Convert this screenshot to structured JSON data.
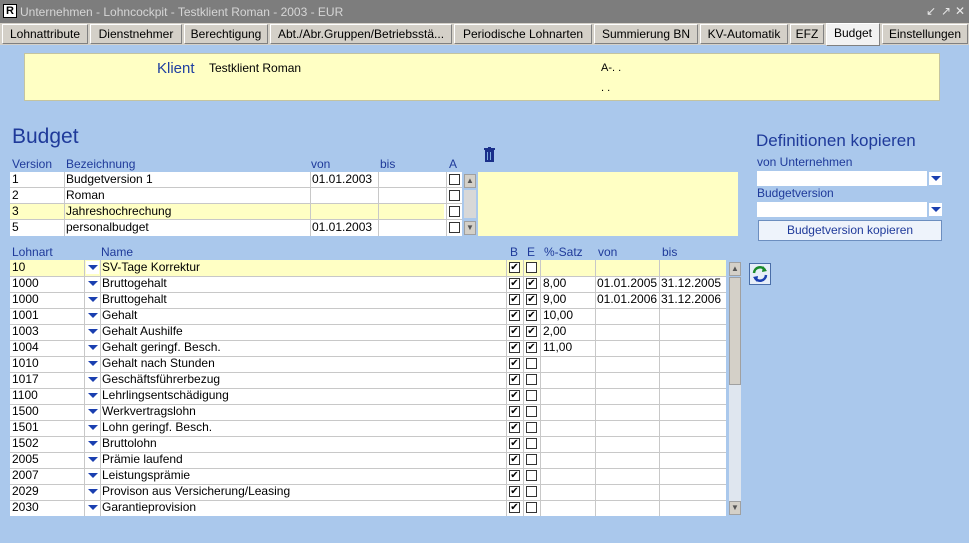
{
  "window": {
    "title": "Unternehmen - Lohncockpit - Testklient Roman - 2003 - EUR",
    "app_icon": "R",
    "controls": [
      "↙",
      "↗",
      "✕"
    ]
  },
  "tabs": [
    {
      "label": "Lohnattribute",
      "active": false
    },
    {
      "label": "Dienstnehmer",
      "active": false
    },
    {
      "label": "Berechtigung",
      "active": false
    },
    {
      "label": "Abt./Abr.Gruppen/Betriebsstä...",
      "active": false
    },
    {
      "label": "Periodische Lohnarten",
      "active": false
    },
    {
      "label": "Summierung BN",
      "active": false
    },
    {
      "label": "KV-Automatik",
      "active": false
    },
    {
      "label": "EFZ",
      "active": false
    },
    {
      "label": "Budget",
      "active": true
    },
    {
      "label": "Einstellungen",
      "active": false
    }
  ],
  "client": {
    "label": "Klient",
    "name": "Testklient Roman",
    "code": "A-. .",
    "dots": ". ."
  },
  "budget": {
    "title": "Budget",
    "headers": {
      "version": "Version",
      "bezeichnung": "Bezeichnung",
      "von": "von",
      "bis": "bis",
      "a": "A"
    },
    "rows": [
      {
        "version": "1",
        "bezeichnung": "Budgetversion 1",
        "von": "01.01.2003",
        "bis": "",
        "a": false
      },
      {
        "version": "2",
        "bezeichnung": "Roman",
        "von": "",
        "bis": "",
        "a": false
      },
      {
        "version": "3",
        "bezeichnung": "Jahreshochrechung",
        "von": "",
        "bis": "",
        "a": false
      },
      {
        "version": "5",
        "bezeichnung": "personalbudget",
        "von": "01.01.2003",
        "bis": "",
        "a": false
      }
    ]
  },
  "lohnarten": {
    "headers": {
      "lohnart": "Lohnart",
      "name": "Name",
      "b": "B",
      "e": "E",
      "satz": "%-Satz",
      "von": "von",
      "bis": "bis"
    },
    "rows": [
      {
        "lohnart": "10",
        "name": "SV-Tage Korrektur",
        "b": true,
        "e": false,
        "satz": "",
        "von": "",
        "bis": ""
      },
      {
        "lohnart": "1000",
        "name": "Bruttogehalt",
        "b": true,
        "e": true,
        "satz": "8,00",
        "von": "01.01.2005",
        "bis": "31.12.2005"
      },
      {
        "lohnart": "1000",
        "name": "Bruttogehalt",
        "b": true,
        "e": true,
        "satz": "9,00",
        "von": "01.01.2006",
        "bis": "31.12.2006"
      },
      {
        "lohnart": "1001",
        "name": "Gehalt",
        "b": true,
        "e": true,
        "satz": "10,00",
        "von": "",
        "bis": ""
      },
      {
        "lohnart": "1003",
        "name": "Gehalt Aushilfe",
        "b": true,
        "e": true,
        "satz": "2,00",
        "von": "",
        "bis": ""
      },
      {
        "lohnart": "1004",
        "name": "Gehalt geringf. Besch.",
        "b": true,
        "e": true,
        "satz": "11,00",
        "von": "",
        "bis": ""
      },
      {
        "lohnart": "1010",
        "name": "Gehalt nach Stunden",
        "b": true,
        "e": false,
        "satz": "",
        "von": "",
        "bis": ""
      },
      {
        "lohnart": "1017",
        "name": "Geschäftsführerbezug",
        "b": true,
        "e": false,
        "satz": "",
        "von": "",
        "bis": ""
      },
      {
        "lohnart": "1100",
        "name": "Lehrlingsentschädigung",
        "b": true,
        "e": false,
        "satz": "",
        "von": "",
        "bis": ""
      },
      {
        "lohnart": "1500",
        "name": "Werkvertragslohn",
        "b": true,
        "e": false,
        "satz": "",
        "von": "",
        "bis": ""
      },
      {
        "lohnart": "1501",
        "name": "Lohn geringf. Besch.",
        "b": true,
        "e": false,
        "satz": "",
        "von": "",
        "bis": ""
      },
      {
        "lohnart": "1502",
        "name": "Bruttolohn",
        "b": true,
        "e": false,
        "satz": "",
        "von": "",
        "bis": ""
      },
      {
        "lohnart": "2005",
        "name": "Prämie laufend",
        "b": true,
        "e": false,
        "satz": "",
        "von": "",
        "bis": ""
      },
      {
        "lohnart": "2007",
        "name": "Leistungsprämie",
        "b": true,
        "e": false,
        "satz": "",
        "von": "",
        "bis": ""
      },
      {
        "lohnart": "2029",
        "name": "Provison aus Versicherung/Leasing",
        "b": true,
        "e": false,
        "satz": "",
        "von": "",
        "bis": ""
      },
      {
        "lohnart": "2030",
        "name": "Garantieprovision",
        "b": true,
        "e": false,
        "satz": "",
        "von": "",
        "bis": ""
      }
    ]
  },
  "kopieren": {
    "title": "Definitionen kopieren",
    "von_unternehmen_label": "von Unternehmen",
    "von_unternehmen_value": "",
    "budgetversion_label": "Budgetversion",
    "budgetversion_value": "",
    "button_label": "Budgetversion kopieren"
  },
  "icons": {
    "refresh": "refresh-icon",
    "delete": "delete-icon"
  },
  "colors": {
    "background": "#aac8ec",
    "row_selected": "#ffffc4",
    "heading": "#1f3a9a",
    "dropdown": "#1a3fb0"
  }
}
